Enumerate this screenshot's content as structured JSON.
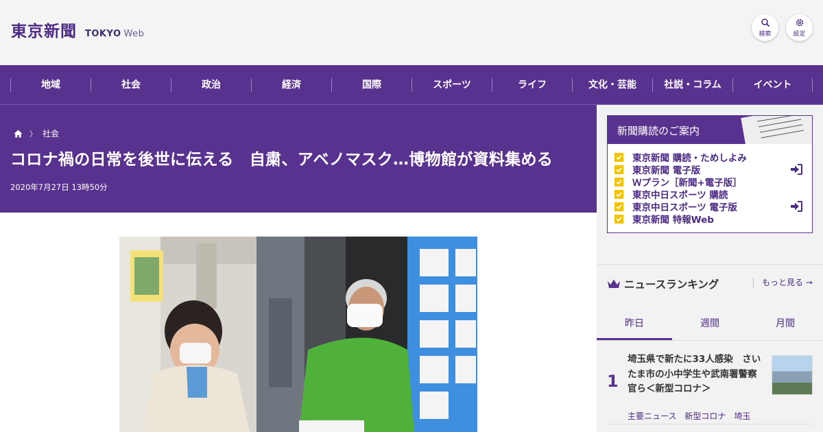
{
  "header": {
    "logo_ja": "東京新聞",
    "logo_en": "TOKYO",
    "logo_web": "Web",
    "search_label": "検索",
    "settings_label": "設定"
  },
  "nav": {
    "items": [
      "地域",
      "社会",
      "政治",
      "経済",
      "国際",
      "スポーツ",
      "ライフ",
      "文化・芸能",
      "社説・コラム",
      "イベント"
    ]
  },
  "article": {
    "breadcrumb": "社会",
    "headline": "コロナ禍の日常を後世に伝える　自粛、アベノマスク…博物館が資料集める",
    "date": "2020年7月27日 13時50分"
  },
  "sidebar": {
    "subscribe_title": "新聞購読のご案内",
    "subscribe_items": [
      "東京新聞 購読・ためしよみ",
      "東京新聞 電子版",
      "Ｗプラン［新聞+電子版］",
      "東京中日スポーツ 購読",
      "東京中日スポーツ 電子版",
      "東京新聞 特報Web"
    ],
    "ranking_title": "ニュースランキング",
    "more_label": "もっと見る",
    "tabs": [
      "昨日",
      "週間",
      "月間"
    ],
    "rank1": {
      "num": "1",
      "title": "埼玉県で新たに33人感染　さいたま市の小中学生や武南署警察官ら＜新型コロナ＞",
      "tags": [
        "主要ニュース",
        "新型コロナ",
        "埼玉"
      ]
    }
  },
  "colors": {
    "brand_purple": "#59318f",
    "check_yellow": "#f2c200"
  }
}
